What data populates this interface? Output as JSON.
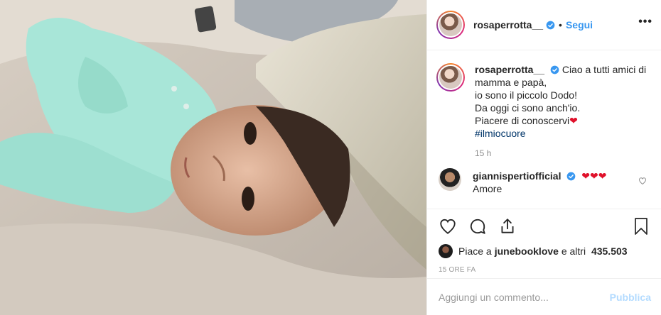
{
  "post": {
    "author": "rosaperrotta__",
    "follow_label": "Segui",
    "more_label": "•••",
    "dot": "•",
    "caption_lines": [
      "Ciao a tutti amici di",
      "mamma e papà,",
      "io sono il piccolo Dodo!",
      "Da oggi ci sono anch'io.",
      "Piacere di conoscervi"
    ],
    "hashtag": "#ilmiocuore",
    "caption_time": "15 h"
  },
  "comment": {
    "author": "giannispertiofficial",
    "hearts": "❤❤❤",
    "text": "Amore"
  },
  "likes": {
    "prefix": "Piace a ",
    "user": "junebooklove",
    "middle": " e altri ",
    "count": "435.503"
  },
  "posted_ago": "15 ORE FA",
  "add_comment": {
    "placeholder": "Aggiungi un commento...",
    "publish_label": "Pubblica"
  },
  "icons": [
    "heart-icon",
    "comment-icon",
    "share-icon",
    "bookmark-icon",
    "verified-icon",
    "more-icon"
  ],
  "colors": {
    "accent": "#3897f0",
    "verified": "#3897f0",
    "heart": "#ed4956",
    "publish_disabled": "#b3dbff"
  }
}
